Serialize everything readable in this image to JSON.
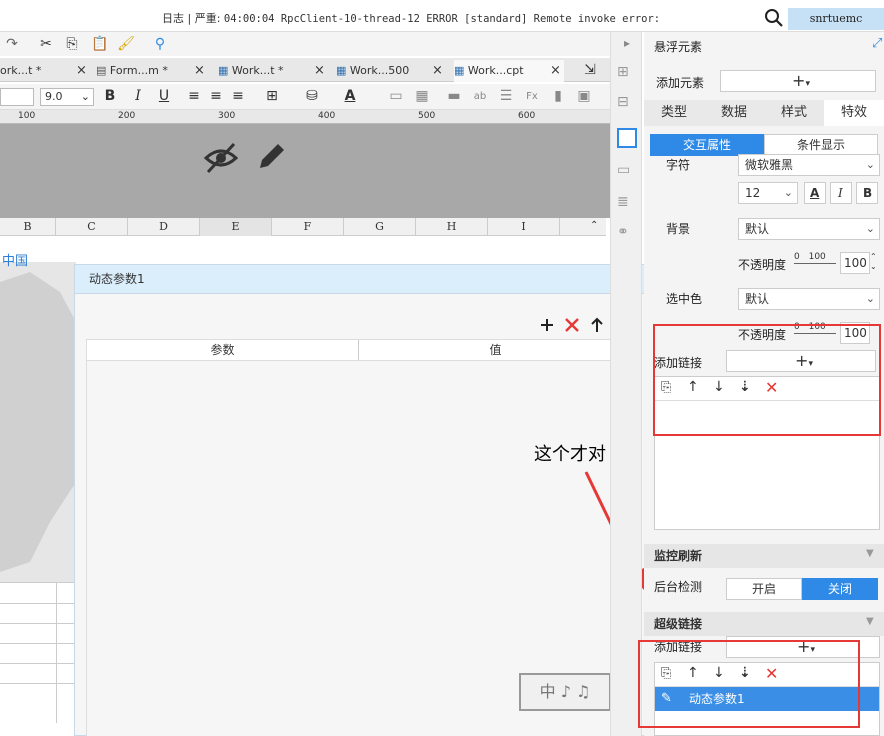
{
  "logbar": {
    "log_label": "日志",
    "severity": "严重:",
    "log_message": "04:00:04 RpcClient-10-thread-12 ERROR [standard] Remote invoke error:",
    "user": "snrtuemc"
  },
  "tabs": [
    {
      "label": "ork...t *"
    },
    {
      "label": "Form...m *"
    },
    {
      "label": "Work...t *"
    },
    {
      "label": "Work...500"
    },
    {
      "label": "Work...cpt"
    }
  ],
  "format": {
    "font_size": "9.0",
    "bold": "B",
    "italic": "I",
    "underline": "U",
    "text_color_letter": "A"
  },
  "ruler": {
    "ticks": [
      "100",
      "200",
      "300",
      "400",
      "500",
      "600"
    ]
  },
  "columns": [
    "B",
    "C",
    "D",
    "E",
    "F",
    "G",
    "H",
    "I"
  ],
  "map": {
    "link": "中国"
  },
  "dialog": {
    "title": "动态参数1",
    "col_param": "参数",
    "col_value": "值"
  },
  "annotation": {
    "text": "这个才对"
  },
  "panel": {
    "title": "悬浮元素",
    "add_element_label": "添加元素",
    "tabs": [
      {
        "label": "类型"
      },
      {
        "label": "数据"
      },
      {
        "label": "样式"
      },
      {
        "label": "特效"
      }
    ],
    "subtabs": [
      {
        "label": "交互属性"
      },
      {
        "label": "条件显示"
      }
    ],
    "font_label": "字符",
    "font_value": "微软雅黑",
    "font_size": "12",
    "bold": "B",
    "italic": "I",
    "text_color_letter": "A",
    "background_label": "背景",
    "background_value": "默认",
    "opacity_label": "不透明度",
    "opacity_slider_min": "0",
    "opacity_slider_max": "100",
    "opacity_value": "100",
    "selected_color_label": "选中色",
    "selected_color_value": "默认",
    "opacity2_label": "不透明度",
    "opacity2_slider_min": "0",
    "opacity2_slider_max": "100",
    "opacity2_value": "100",
    "add_link_label": "添加链接",
    "monitor_section": "监控刷新",
    "bg_check_label": "后台检测",
    "toggle_on": "开启",
    "toggle_off": "关闭",
    "hyperlink_section": "超级链接",
    "add_link2_label": "添加链接",
    "link_item": "动态参数1"
  },
  "colors": {
    "accent": "#2e8ae6",
    "red_box": "#e53935",
    "selected_row": "#3a8ee6"
  },
  "watermark": {
    "text": "中 ♪ ♫"
  }
}
